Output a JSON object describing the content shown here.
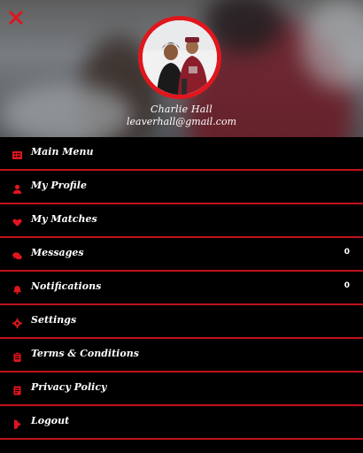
{
  "profile": {
    "name": "Charlie Hall",
    "email": "leaverhall@gmail.com"
  },
  "icons": {
    "close": "close-icon",
    "accent": "#e0161d"
  },
  "menu": [
    {
      "label": "Main Menu",
      "icon": "list-icon",
      "count": ""
    },
    {
      "label": "My Profile",
      "icon": "user-icon",
      "count": ""
    },
    {
      "label": "My Matches",
      "icon": "heart-icon",
      "count": ""
    },
    {
      "label": "Messages",
      "icon": "chat-icon",
      "count": "0"
    },
    {
      "label": "Notifications",
      "icon": "bell-icon",
      "count": "0"
    },
    {
      "label": "Settings",
      "icon": "gear-icon",
      "count": ""
    },
    {
      "label": "Terms & Conditions",
      "icon": "clipboard-icon",
      "count": ""
    },
    {
      "label": "Privacy Policy",
      "icon": "document-icon",
      "count": ""
    },
    {
      "label": "Logout",
      "icon": "logout-icon",
      "count": ""
    }
  ]
}
